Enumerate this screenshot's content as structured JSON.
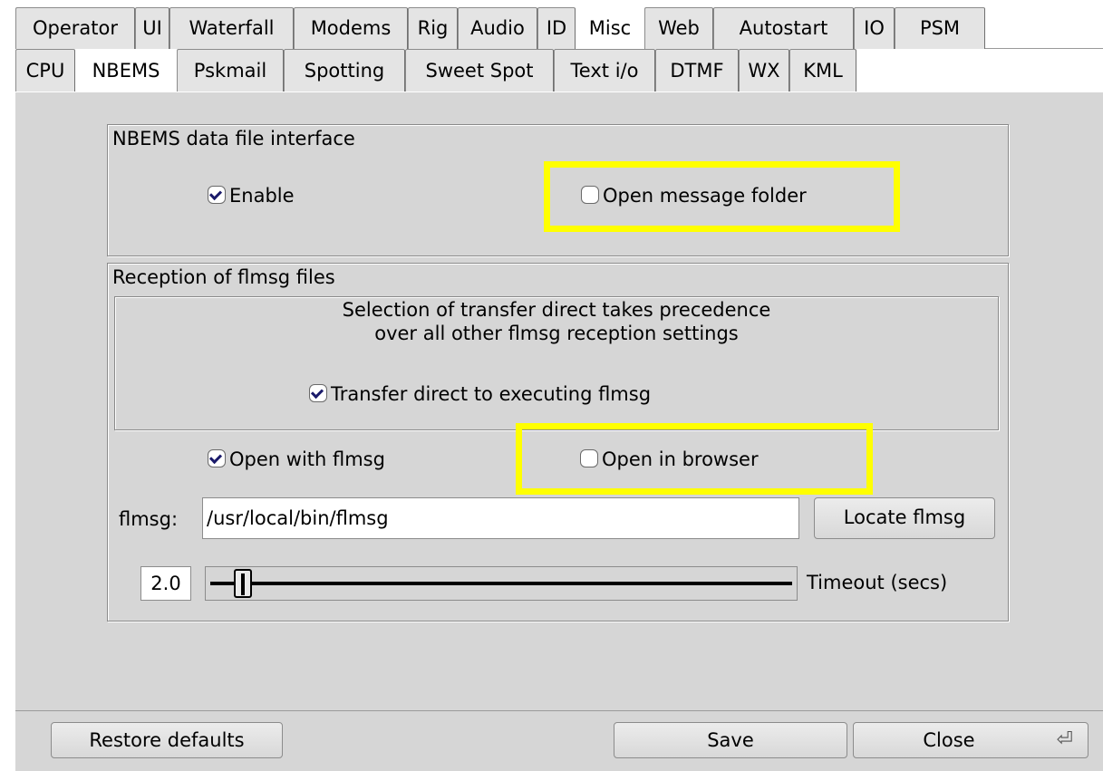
{
  "tabs_row1": [
    "Operator",
    "UI",
    "Waterfall",
    "Modems",
    "Rig",
    "Audio",
    "ID",
    "Misc",
    "Web",
    "Autostart",
    "IO",
    "PSM"
  ],
  "tabs_row1_active": "Misc",
  "tabs_row2": [
    "CPU",
    "NBEMS",
    "Pskmail",
    "Spotting",
    "Sweet Spot",
    "Text i/o",
    "DTMF",
    "WX",
    "KML"
  ],
  "tabs_row2_active": "NBEMS",
  "nbems_group": {
    "title": "NBEMS data file interface",
    "enable_label": "Enable",
    "enable_checked": true,
    "open_folder_label": "Open message folder",
    "open_folder_checked": false
  },
  "reception_group": {
    "title": "Reception of flmsg files",
    "notice_line1": "Selection of transfer direct takes precedence",
    "notice_line2": "over all other flmsg reception settings",
    "transfer_label": "Transfer direct to executing flmsg",
    "transfer_checked": true,
    "open_flmsg_label": "Open with flmsg",
    "open_flmsg_checked": true,
    "open_browser_label": "Open in browser",
    "open_browser_checked": false,
    "flmsg_field_label": "flmsg:",
    "flmsg_path": "/usr/local/bin/flmsg",
    "locate_button": "Locate flmsg",
    "timeout_value": "2.0",
    "timeout_label": "Timeout (secs)"
  },
  "bottom": {
    "restore_label": "Restore defaults",
    "save_label": "Save",
    "close_label": "Close"
  },
  "colors": {
    "panel_bg": "#d6d6d6",
    "highlight": "#ffff00"
  }
}
